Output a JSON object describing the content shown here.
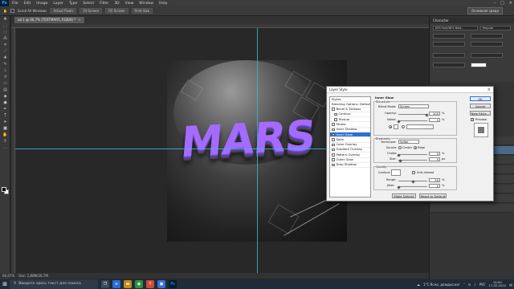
{
  "app": {
    "name": "Ps",
    "essentials": "Основная среда"
  },
  "menu": [
    "File",
    "Edit",
    "Image",
    "Layer",
    "Type",
    "Select",
    "Filter",
    "3D",
    "View",
    "Window",
    "Help"
  ],
  "options_bar": {
    "scroll_all": "Scroll All Windows",
    "b1": "Actual Pixels",
    "b2": "Fit Screen",
    "b3": "Fill Screen",
    "b4": "Print Size"
  },
  "document_tab": {
    "title": "ad 1 @ 66,7% (TEXTMARS, RGB/8) *",
    "close": "×"
  },
  "status_bar": {
    "zoom": "66,67%",
    "doc": "Doc: 2,88M/36,7M"
  },
  "canvas": {
    "logo_text": "MARS"
  },
  "right_panel": {
    "title": "Character",
    "font": "NFS Font/NFS Bold...",
    "style": "Regular"
  },
  "dialog": {
    "title": "Layer Style",
    "close": "×",
    "styles_header": "Styles",
    "styles": [
      {
        "label": "Blending Options: Default",
        "check": false,
        "indent": false,
        "sel": false,
        "nocheck": true
      },
      {
        "label": "Bevel & Emboss",
        "check": false,
        "indent": false,
        "sel": false
      },
      {
        "label": "Contour",
        "check": false,
        "indent": true,
        "sel": false
      },
      {
        "label": "Texture",
        "check": false,
        "indent": true,
        "sel": false
      },
      {
        "label": "Stroke",
        "check": false,
        "indent": false,
        "sel": false
      },
      {
        "label": "Inner Shadow",
        "check": false,
        "indent": false,
        "sel": false
      },
      {
        "label": "Inner Glow",
        "check": true,
        "indent": false,
        "sel": true
      },
      {
        "label": "Satin",
        "check": false,
        "indent": false,
        "sel": false
      },
      {
        "label": "Color Overlay",
        "check": false,
        "indent": false,
        "sel": false
      },
      {
        "label": "Gradient Overlay",
        "check": false,
        "indent": false,
        "sel": false
      },
      {
        "label": "Pattern Overlay",
        "check": false,
        "indent": false,
        "sel": false
      },
      {
        "label": "Outer Glow",
        "check": false,
        "indent": false,
        "sel": false
      },
      {
        "label": "Drop Shadow",
        "check": false,
        "indent": false,
        "sel": false
      }
    ],
    "inner_glow": "Inner Glow",
    "structure": "Structure",
    "blend_mode_label": "Blend Mode:",
    "blend_mode": "Screen",
    "opacity_label": "Opacity:",
    "opacity": "100",
    "noise_label": "Noise:",
    "noise": "0",
    "elements": "Elements",
    "technique_label": "Technique:",
    "technique": "Softer",
    "source_label": "Source:",
    "center": "Center",
    "edge": "Edge",
    "choke_label": "Choke:",
    "choke": "0",
    "size_label": "Size:",
    "size": "5",
    "quality": "Quality",
    "contour_label": "Contour:",
    "anti_aliased": "Anti-aliased",
    "range_label": "Range:",
    "range": "50",
    "jitter_label": "Jitter:",
    "jitter": "0",
    "pct": "%",
    "px": "px",
    "make_default": "Make Default",
    "reset_default": "Reset to Default",
    "ok": "OK",
    "cancel": "Cancel",
    "new_style": "New Style...",
    "preview": "Preview"
  },
  "taskbar": {
    "search": "Введите здесь текст для поиска",
    "weather": "1°C  Ясно, дождь/снег",
    "lang": "РУС",
    "time": "14:00",
    "date": "17.02.2022"
  }
}
